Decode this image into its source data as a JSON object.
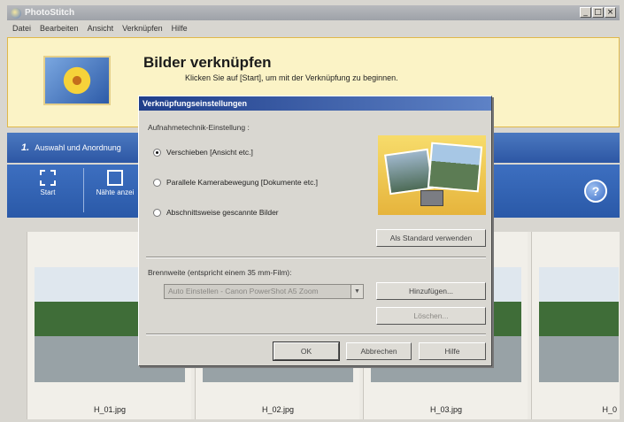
{
  "window": {
    "title": "PhotoStitch"
  },
  "menu": [
    "Datei",
    "Bearbeiten",
    "Ansicht",
    "Verknüpfen",
    "Hilfe"
  ],
  "header": {
    "title": "Bilder verknüpfen",
    "subtitle": "Klicken Sie auf [Start], um mit der Verknüpfung zu beginnen."
  },
  "steps": {
    "number": "1.",
    "label": "Auswahl und Anordnung"
  },
  "toolbar": {
    "start_label": "Start",
    "second_label": "Nähte anzei"
  },
  "thumbnails": [
    "H_01.jpg",
    "H_02.jpg",
    "H_03.jpg",
    "H_0"
  ],
  "dialog": {
    "title": "Verknüpfungseinstellungen",
    "technique_label": "Aufnahmetechnik-Einstellung :",
    "options": [
      "Verschieben [Ansicht etc.]",
      "Parallele Kamerabewegung [Dokumente etc.]",
      "Abschnittsweise gescannte Bilder"
    ],
    "selected_option": 0,
    "default_button": "Als Standard verwenden",
    "focal_label": "Brennweite (entspricht einem 35 mm-Film):",
    "focal_value": "Auto Einstellen - Canon PowerShot A5 Zoom",
    "add_button": "Hinzufügen...",
    "delete_button": "Löschen...",
    "ok_button": "OK",
    "cancel_button": "Abbrechen",
    "help_button": "Hilfe"
  }
}
